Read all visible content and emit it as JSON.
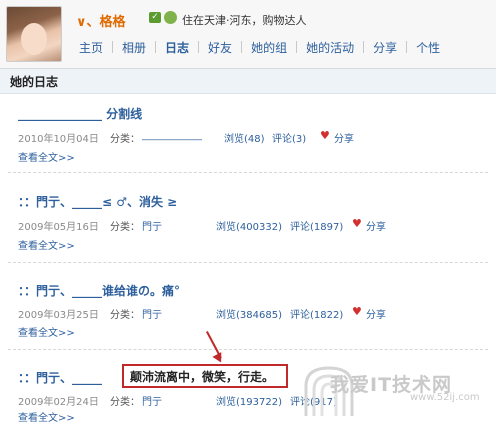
{
  "profile": {
    "username": "∨、格格",
    "location": "住在天津·河东，购物达人"
  },
  "nav": [
    {
      "label": "主页"
    },
    {
      "label": "相册"
    },
    {
      "label": "日志"
    },
    {
      "label": "好友"
    },
    {
      "label": "她的组"
    },
    {
      "label": "她的活动"
    },
    {
      "label": "分享"
    },
    {
      "label": "个性"
    }
  ],
  "section": {
    "title": "她的日志"
  },
  "labels": {
    "category": "分类：",
    "read_more": "查看全文>>",
    "share": "分享"
  },
  "entries": [
    {
      "title": "______________ 分割线",
      "date": "2010年10月04日",
      "category": "____________",
      "views": "浏览(48)",
      "comments": "评论(3)"
    },
    {
      "title": "：：門亍、_____≤      ♂、消失 ≥",
      "date": "2009年05月16日",
      "category": "門亍",
      "views": "浏览(400332)",
      "comments": "评论(1897)"
    },
    {
      "title": "：：門亍、_____谁给谁の。痛°",
      "date": "2009年03月25日",
      "category": "門亍",
      "views": "浏览(384685)",
      "comments": "评论(1822)"
    },
    {
      "title": "：：門亍、_____",
      "date": "2009年02月24日",
      "category": "門亍",
      "views": "浏览(193722)",
      "comments": "评论(917)"
    }
  ],
  "highlight_text": "颠沛流离中，微笑，行走。",
  "watermark": {
    "text": "我爱IT技术网",
    "url": "www.52ij.com"
  }
}
